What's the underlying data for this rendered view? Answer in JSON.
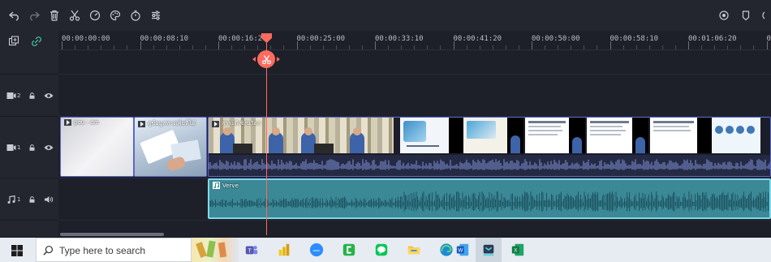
{
  "toolbar": {
    "tools": [
      {
        "name": "undo-icon"
      },
      {
        "name": "redo-icon"
      },
      {
        "name": "trash-icon"
      },
      {
        "name": "scissors-icon"
      },
      {
        "name": "speed-icon"
      },
      {
        "name": "color-palette-icon"
      },
      {
        "name": "timer-icon"
      },
      {
        "name": "adjust-icon"
      }
    ],
    "right_tools": [
      {
        "name": "render-icon"
      },
      {
        "name": "marker-icon"
      }
    ]
  },
  "ruler": {
    "labels": [
      "00:00:00:00",
      "00:00:08:10",
      "00:00:16:20",
      "00:00:25:00",
      "00:00:33:10",
      "00:00:41:20",
      "00:00:50:00",
      "00:00:58:10",
      "00:01:06:20",
      "00:0"
    ]
  },
  "tracks": {
    "video2": {
      "number": "2"
    },
    "video1": {
      "number": "1"
    },
    "audio1": {
      "number": "1"
    }
  },
  "clips": {
    "clip1": {
      "title": "pou - cm"
    },
    "clip2": {
      "title": "ดูข้อมูลทางเพิ่มที่ได้"
    },
    "clip3": {
      "title": "สาระดีเชิงนวัตก"
    },
    "audio": {
      "title": "Verve"
    }
  },
  "taskbar": {
    "search_placeholder": "Type here to search",
    "apps": [
      {
        "name": "teams-icon"
      },
      {
        "name": "power-bi-icon"
      },
      {
        "name": "zoom-icon"
      },
      {
        "name": "camtasia-icon"
      },
      {
        "name": "line-icon"
      },
      {
        "name": "file-explorer-icon"
      },
      {
        "name": "edge-icon"
      },
      {
        "name": "word-icon"
      },
      {
        "name": "filmora-icon"
      },
      {
        "name": "excel-icon"
      }
    ]
  },
  "colors": {
    "playhead": "#ff6b5e",
    "audio_clip": "#3b8896",
    "audio_selected_border": "#7fd8e8",
    "video_clip_border": "#5b68c8"
  }
}
